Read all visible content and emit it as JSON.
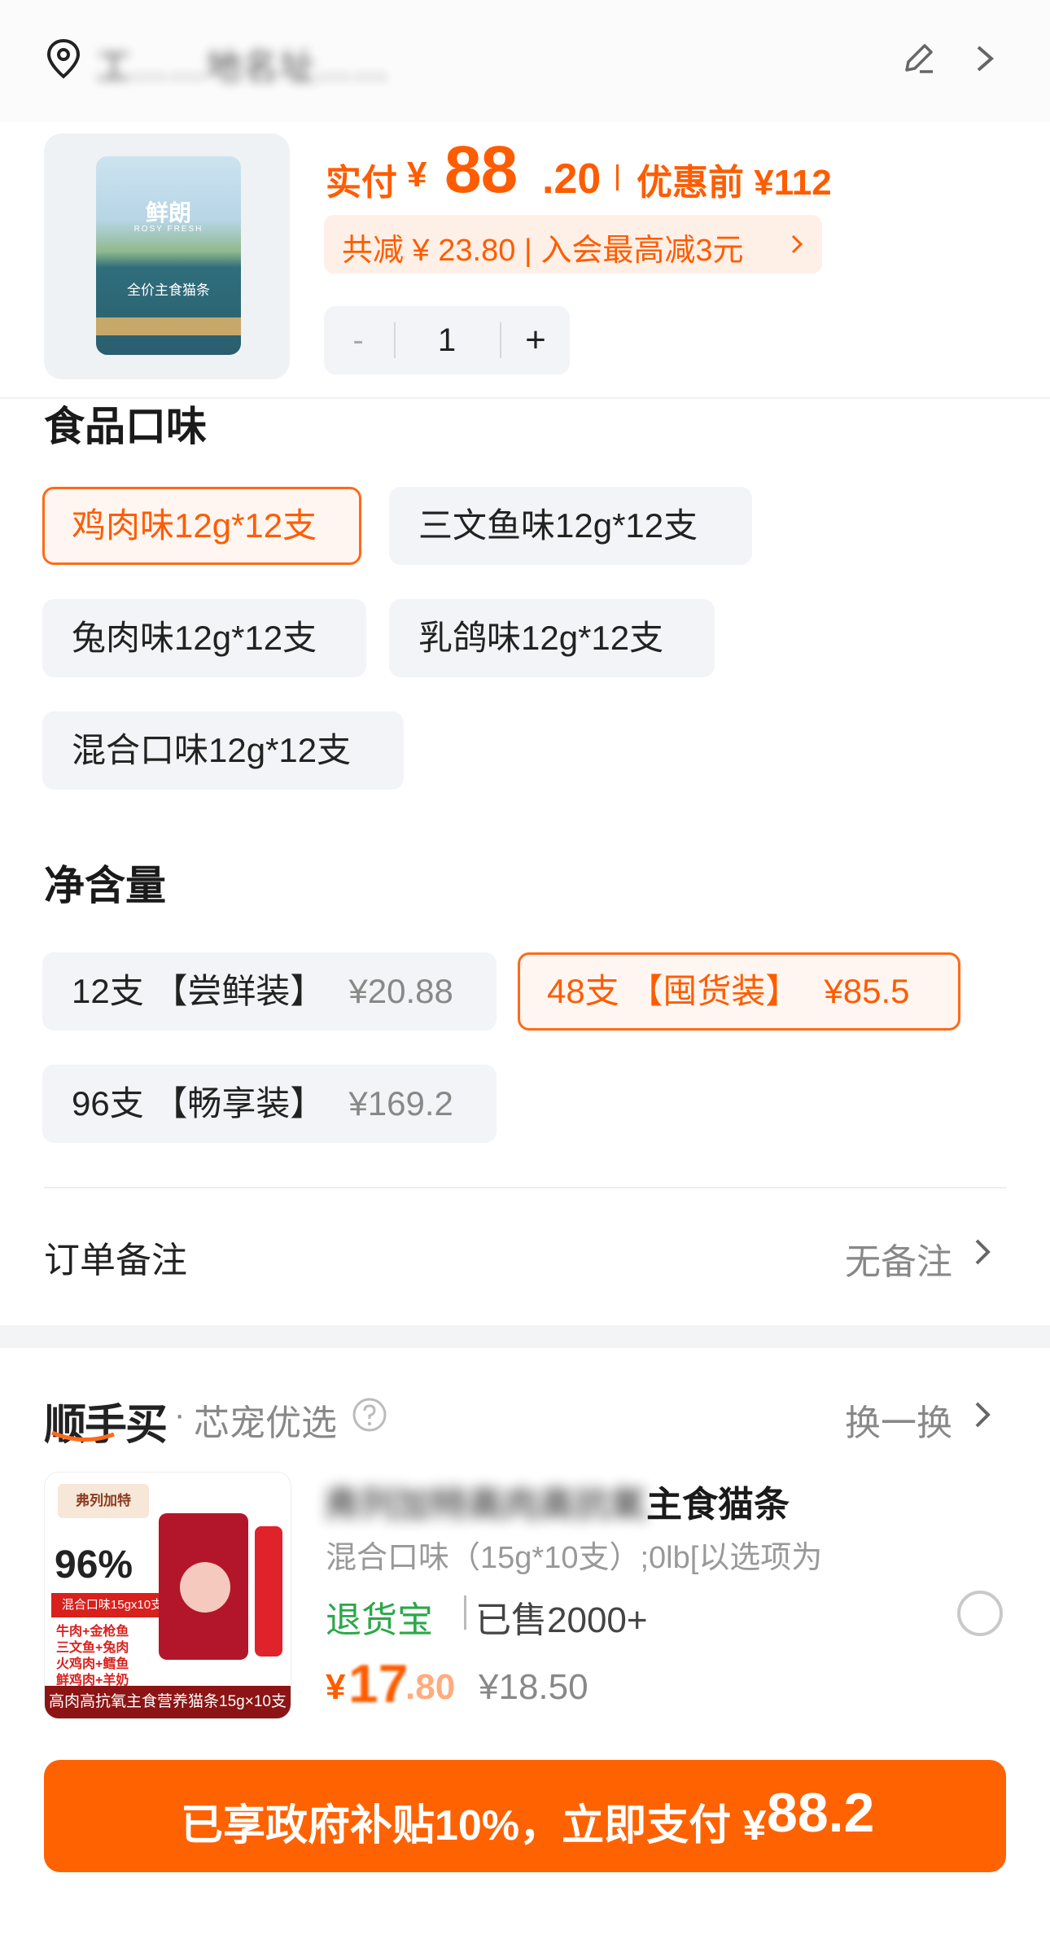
{
  "address": {
    "text": "工……地名址……"
  },
  "product": {
    "pack_brand": "鲜朗",
    "pack_brand_sub": "ROSY FRESH",
    "pack_band": "全价主食猫条",
    "price_label": "实付",
    "price_currency": "¥",
    "price_integer": "88",
    "price_decimal": ".20",
    "price_before": "优惠前 ¥112",
    "discount_text": "共减 ¥ 23.80 | 入会最高减3元",
    "quantity": "1",
    "minus": "-",
    "plus": "+"
  },
  "flavor": {
    "title": "食品口味",
    "options": [
      {
        "label": "鸡肉味12g*12支",
        "selected": true
      },
      {
        "label": "三文鱼味12g*12支",
        "selected": false
      },
      {
        "label": "兔肉味12g*12支",
        "selected": false
      },
      {
        "label": "乳鸽味12g*12支",
        "selected": false
      },
      {
        "label": "混合口味12g*12支",
        "selected": false
      }
    ]
  },
  "net": {
    "title": "净含量",
    "options": [
      {
        "label": "12支 【尝鲜装】",
        "price": "¥20.88",
        "selected": false
      },
      {
        "label": "48支 【囤货装】",
        "price": "¥85.5",
        "selected": true
      },
      {
        "label": "96支 【畅享装】",
        "price": "¥169.2",
        "selected": false
      }
    ]
  },
  "order_note": {
    "label": "订单备注",
    "value": "无备注"
  },
  "recommend": {
    "logo": "顺手买",
    "dot": "·",
    "subtitle": "芯宠优选",
    "swap_label": "换一换",
    "thumb": {
      "tag": "弗列加特",
      "big": "96%",
      "red_band": "混合口味15gx10支",
      "lines": [
        "牛肉+金枪鱼",
        "三文鱼+兔肉",
        "火鸡肉+鳕鱼",
        "鲜鸡肉+羊奶"
      ],
      "foot": "高肉高抗氧主食营养猫条15g×10支"
    },
    "title_blurred": "弗列加特高肉高抗氧",
    "title_visible": "主食猫条",
    "spec": "混合口味（15g*10支）;0lb[以选项为",
    "return_tag": "退货宝",
    "sold": "已售2000+",
    "price_currency": "¥",
    "price_integer": "17",
    "price_decimal": ".80",
    "price_original": "¥18.50"
  },
  "pay": {
    "label": "已享政府补贴10%，立即支付 ¥",
    "amount": "88.2"
  },
  "colors": {
    "accent": "#ff5c00",
    "button": "#ff6200",
    "green": "#2aa84a"
  }
}
